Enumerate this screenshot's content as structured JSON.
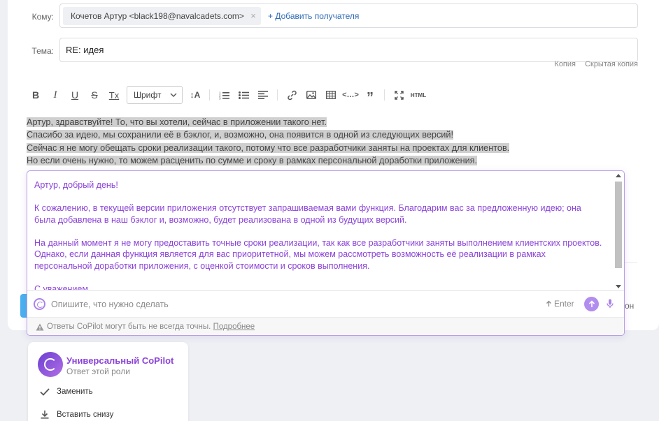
{
  "to": {
    "label": "Кому:",
    "recipient": "Кочетов Артур <black198@navalcadets.com>",
    "remove_glyph": "×",
    "add_recipient": "+ Добавить получателя"
  },
  "subject": {
    "label": "Тема:",
    "value": "RE: идея"
  },
  "cc_links": {
    "cc": "Копия",
    "bcc": "Скрытая копия"
  },
  "toolbar": {
    "bold": "B",
    "italic": "I",
    "underline": "U",
    "strike": "S",
    "clear_format": "Tx",
    "font_label": "Шрифт",
    "font_size": "↕A",
    "html": "HTML",
    "quote": "”",
    "code": "<…>"
  },
  "quoted_lines": [
    "Артур, здравствуйте! То, что вы хотели, сейчас в приложении такого нет.",
    "Спасибо за идею, мы сохранили её в бэклог, и, возможно, она появится в одной из следующих версий!",
    "Сейчас я не могу обещать сроки реализации такого, потому что все разработчики заняты на проектах для клиентов.",
    "Но если очень нужно, то можем расценить по сумме и сроку в рамках персональной доработки приложения."
  ],
  "reply_paragraphs": [
    "Артур, добрый день!",
    "К сожалению, в текущей версии приложения отсутствует запрашиваемая вами функция. Благодарим вас за предложенную идею; она была добавлена в наш бэклог и, возможно, будет реализована в одной из будущих версий.",
    "На данный момент я не могу предоставить точные сроки реализации, так как все разработчики заняты выполнением клиентских проектов. Однако, если данная функция является для вас приоритетной, мы можем рассмотреть возможность её реализации в рамках персональной доработки приложения, с оценкой стоимости и сроков выполнения.",
    "С уважением,"
  ],
  "prompt": {
    "placeholder": "Опишите, что нужно сделать",
    "enter_hint": "Enter"
  },
  "disclaimer": {
    "text": "Ответы CoPilot могут быть не всегда точны.",
    "more": "Подробнее"
  },
  "peek_right_text": "он",
  "role": {
    "title": "Универсальный CoPilot",
    "subtitle": "Ответ этой роли",
    "replace": "Заменить",
    "insert_below": "Вставить снизу"
  },
  "colors": {
    "accent_purple": "#8b44d8",
    "link_blue": "#2f6cb5",
    "send_button": "#b18df0"
  }
}
